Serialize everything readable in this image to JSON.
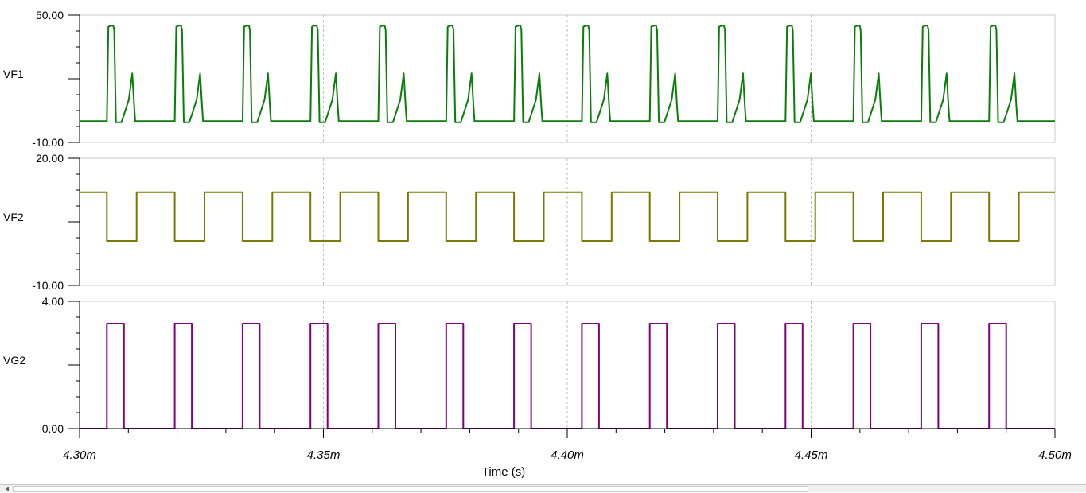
{
  "chart_data": {
    "type": "line",
    "xlabel": "Time (s)",
    "x_range": [
      4.3,
      4.5
    ],
    "x_ticks": [
      4.3,
      4.35,
      4.4,
      4.45,
      4.5
    ],
    "x_tick_labels": [
      "4.30m",
      "4.35m",
      "4.40m",
      "4.45m",
      "4.50m"
    ],
    "x_unit_multiplier": 0.001,
    "vertical_grid_at": [
      4.35,
      4.4,
      4.45
    ],
    "switching_period": 0.013915,
    "first_edge": 4.3056,
    "pulse_count": 14,
    "channels": [
      {
        "name": "VF1",
        "color": "#0b7d0b",
        "ylim": [
          -10,
          50
        ],
        "y_tick_labels": [
          "50.00",
          "-10.00"
        ],
        "baseline": 0,
        "peak": 45,
        "ringing_peak": 22.5,
        "dip": -0.5
      },
      {
        "name": "VF2",
        "color": "#7a7a00",
        "ylim": [
          -10,
          20
        ],
        "y_tick_labels": [
          "20.00",
          "-10.00"
        ],
        "high": 12,
        "low": 0.5
      },
      {
        "name": "VG2",
        "color": "#800080",
        "ylim": [
          0,
          4
        ],
        "y_tick_labels": [
          "4.00",
          "0.00"
        ],
        "high": 3.3,
        "low": 0
      }
    ]
  }
}
